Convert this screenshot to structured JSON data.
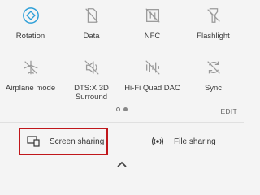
{
  "tiles": [
    {
      "label": "Rotation",
      "icon": "rotation-icon",
      "active": true
    },
    {
      "label": "Data",
      "icon": "mobile-data-icon",
      "active": false
    },
    {
      "label": "NFC",
      "icon": "nfc-icon",
      "active": false
    },
    {
      "label": "Flashlight",
      "icon": "flashlight-icon",
      "active": false
    },
    {
      "label": "Airplane mode",
      "icon": "airplane-icon",
      "active": false
    },
    {
      "label": "DTS:X 3D\nSurround",
      "icon": "dts-surround-icon",
      "active": false
    },
    {
      "label": "Hi-Fi Quad DAC",
      "icon": "hifi-dac-icon",
      "active": false
    },
    {
      "label": "Sync",
      "icon": "sync-icon",
      "active": false
    }
  ],
  "edit_label": "EDIT",
  "pager": {
    "pages": 2,
    "current": 2
  },
  "share": {
    "screen_label": "Screen sharing",
    "file_label": "File sharing"
  },
  "colors": {
    "active": "#2d9fd8",
    "inactive": "#9a9a9a",
    "highlight": "#c0171b",
    "background": "#f4f4f4"
  }
}
